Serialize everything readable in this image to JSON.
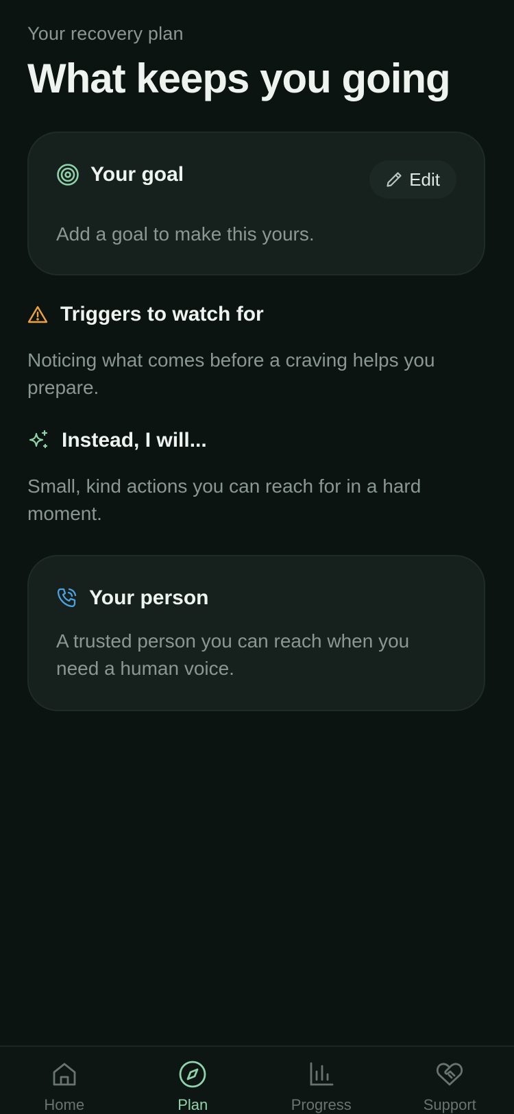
{
  "header": {
    "eyebrow": "Your recovery plan",
    "title": "What keeps you going"
  },
  "goal_card": {
    "icon": "target-icon",
    "title": "Your goal",
    "edit_label": "Edit",
    "edit_icon": "pencil-icon",
    "body": "Add a goal to make this yours."
  },
  "triggers": {
    "icon": "warning-icon",
    "title": "Triggers to watch for",
    "body": "Noticing what comes before a craving helps you prepare."
  },
  "instead": {
    "icon": "sparkle-icon",
    "title": "Instead, I will...",
    "body": "Small, kind actions you can reach for in a hard moment."
  },
  "person_card": {
    "icon": "phone-call-icon",
    "title": "Your person",
    "body": "A trusted person you can reach when you need a human voice."
  },
  "nav": {
    "items": [
      {
        "label": "Home",
        "icon": "home-icon",
        "active": false
      },
      {
        "label": "Plan",
        "icon": "compass-icon",
        "active": true
      },
      {
        "label": "Progress",
        "icon": "bar-chart-icon",
        "active": false
      },
      {
        "label": "Support",
        "icon": "heart-handshake-icon",
        "active": false
      }
    ]
  },
  "colors": {
    "background": "#0c1412",
    "card": "#16201d",
    "accent": "#8fd3ab",
    "warning": "#f0a33a",
    "phone": "#4aa3e0",
    "text_muted": "#8a9792"
  }
}
